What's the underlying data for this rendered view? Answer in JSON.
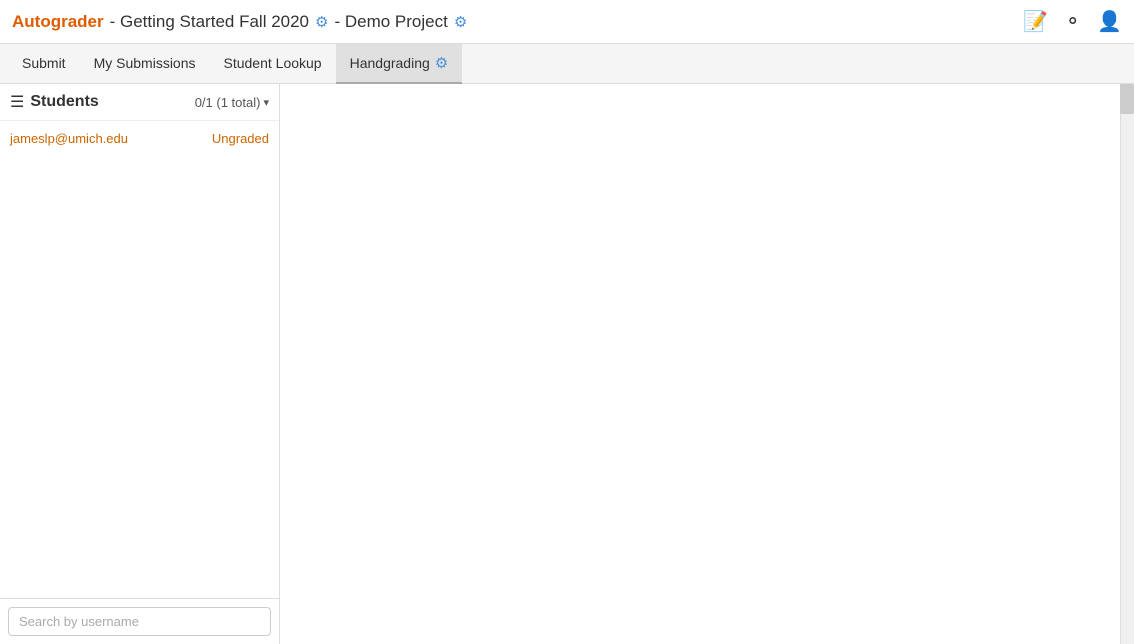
{
  "header": {
    "app_name": "Autograder",
    "separator": " - Getting Started Fall 2020 ",
    "gear1_label": "⚙",
    "project_separator": " - Demo Project ",
    "gear2_label": "⚙",
    "icons": {
      "doc": "🗒",
      "github": "🐙",
      "user": "👤"
    }
  },
  "navbar": {
    "items": [
      {
        "label": "Submit",
        "active": false
      },
      {
        "label": "My Submissions",
        "active": false
      },
      {
        "label": "Student Lookup",
        "active": false
      },
      {
        "label": "Handgrading",
        "active": true
      }
    ],
    "handgrading_gear": "⚙"
  },
  "sidebar": {
    "title": "Students",
    "count": "0/1 (1 total)",
    "dropdown_arrow": "▾",
    "students": [
      {
        "email": "jameslp@umich.edu",
        "status": "Ungraded"
      }
    ],
    "search_placeholder": "Search by username"
  },
  "content": {
    "empty": ""
  }
}
